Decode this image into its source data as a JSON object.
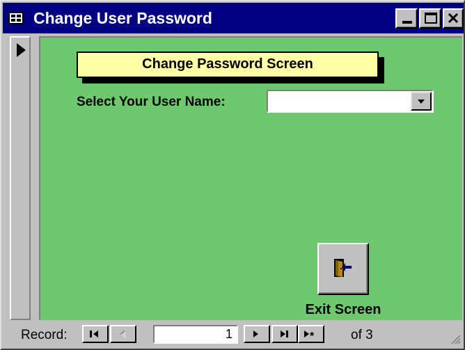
{
  "window": {
    "title": "Change User Password"
  },
  "form": {
    "header_label": "Change Password Screen",
    "user_name_label": "Select  Your User Name:",
    "user_name_value": "",
    "exit_label": "Exit Screen",
    "background_color": "#6ec96e",
    "header_color": "#ffffa8"
  },
  "navigation": {
    "record_label": "Record:",
    "current_record": "1",
    "of_total": "of 3"
  },
  "icons": {
    "app": "form-icon",
    "minimize": "minimize-icon",
    "maximize": "maximize-icon",
    "close": "close-icon",
    "exit": "exit-door-icon",
    "dropdown": "chevron-down-icon"
  }
}
